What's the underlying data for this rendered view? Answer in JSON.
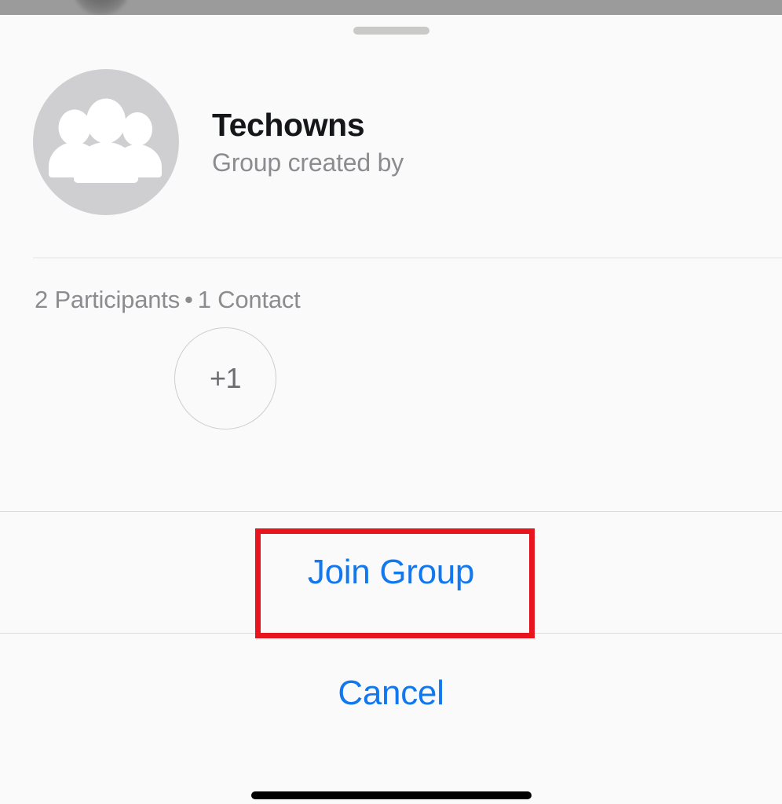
{
  "sheet": {
    "grabber_name": "sheet-grabber"
  },
  "group": {
    "name": "Techowns",
    "created_by_label": "Group created by",
    "avatar_icon": "group-people-icon"
  },
  "participants": {
    "count_label": "2 Participants",
    "separator": "•",
    "contacts_label": "1 Contact",
    "overflow_chip": "+1"
  },
  "actions": {
    "join_label": "Join Group",
    "cancel_label": "Cancel"
  },
  "annotation": {
    "target": "Join Group",
    "color": "#e8151f"
  },
  "colors": {
    "accent_blue": "#1178ef",
    "background": "#fafafa",
    "title_text": "#15161a",
    "secondary_text": "#8c8c90",
    "avatar_bg": "#cfcfd1",
    "divider": "#dcdcde",
    "dim_overlay": "#9b9b9b",
    "highlight_red": "#e8151f",
    "home_indicator": "#000000"
  }
}
